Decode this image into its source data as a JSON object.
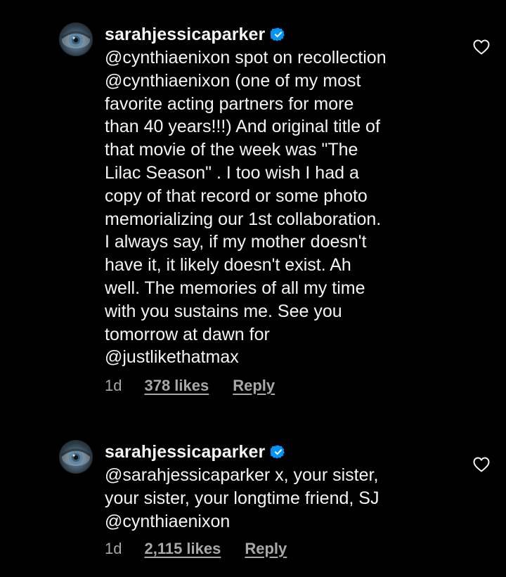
{
  "colors": {
    "background": "#000000",
    "text": "#f5f5f5",
    "secondary": "#a8a8a8",
    "verified_badge": "#0095f6"
  },
  "comments": [
    {
      "username": "sarahjessicaparker",
      "verified": true,
      "avatar_icon": "eye-avatar",
      "lines": [
        "@cynthiaenixon spot on recollection",
        "@cynthiaenixon (one of my most",
        "favorite acting partners for more",
        "than 40 years!!!) And original title of",
        "that movie of the week was \"The",
        "Lilac Season\" . I too wish I had a",
        "copy of that record or some photo",
        "memorializing our 1st collaboration.",
        "I always say, if my mother doesn't",
        "have it, it likely doesn't exist. Ah",
        "well. The memories of all my time",
        "with you sustains me. See you",
        "tomorrow at dawn for",
        "@justlikethatmax"
      ],
      "time": "1d",
      "likes": "378 likes",
      "reply": "Reply",
      "like_icon": "heart-outline-icon"
    },
    {
      "username": "sarahjessicaparker",
      "verified": true,
      "avatar_icon": "eye-avatar",
      "lines": [
        "@sarahjessicaparker x, your sister,",
        "your sister, your longtime friend, SJ",
        "@cynthiaenixon"
      ],
      "time": "1d",
      "likes": "2,115 likes",
      "reply": "Reply",
      "like_icon": "heart-outline-icon"
    }
  ]
}
